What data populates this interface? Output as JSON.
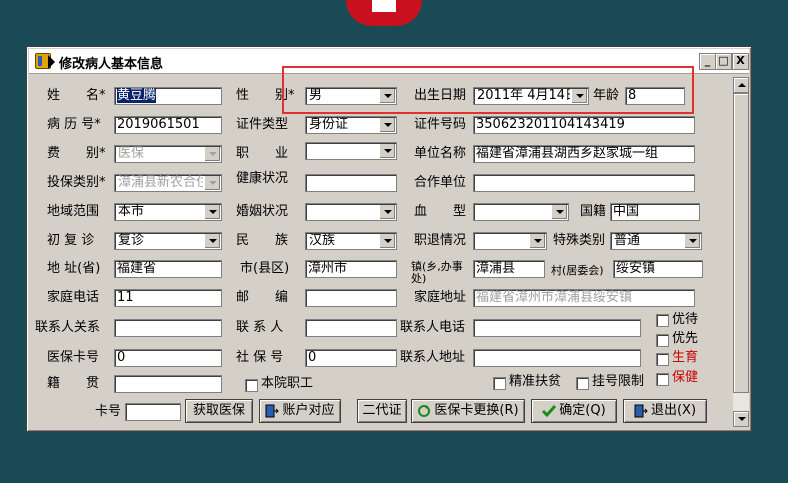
{
  "window": {
    "title": "修改病人基本信息",
    "minimize": "_",
    "maximize": "□",
    "close": "X"
  },
  "labels": {
    "name": "姓　　名*",
    "gender": "性　　别*",
    "birth": "出生日期",
    "age": "年龄",
    "record_no": "病 历 号*",
    "id_type": "证件类型",
    "id_no": "证件号码",
    "fee_type": "费　　别*",
    "job": "职　　业",
    "employer": "单位名称",
    "insure_type": "投保类别*",
    "health": "健康状况",
    "coop": "合作单位",
    "region": "地域范围",
    "marital": "婚姻状况",
    "blood": "血　　型",
    "nationality": "国籍",
    "visit": "初 复 诊",
    "ethnic": "民　　族",
    "retire": "职退情况",
    "special": "特殊类别",
    "province": "地 址(省)",
    "city": "市(县区)",
    "town": "镇(乡,办事处)",
    "village": "村(居委会)",
    "home_phone": "家庭电话",
    "postcode": "邮　　编",
    "home_addr": "家庭地址",
    "contact_rel": "联系人关系",
    "contact": "联 系 人",
    "contact_phone": "联系人电话",
    "insure_card": "医保卡号",
    "social_no": "社 保 号",
    "contact_addr": "联系人地址",
    "native": "籍　　贯",
    "staff": "本院职工",
    "precise": "精准扶贫",
    "reg_limit": "挂号限制",
    "priority": "优待",
    "first": "优先",
    "birth_care": "生育",
    "health_care": "保健",
    "card_no": "卡号"
  },
  "values": {
    "name": "黄豆腾",
    "gender": "男",
    "birth": "2011年  4月14日",
    "age": "8",
    "record_no": "2019061501",
    "id_type": "身份证",
    "id_no": "350623201104143419",
    "fee_type": "医保",
    "job": "",
    "employer": "福建省漳浦县湖西乡赵家城一组",
    "insure_type": "漳浦县新农合住院",
    "health": "",
    "coop": "",
    "region": "本市",
    "marital": "",
    "blood": "",
    "nationality": "中国",
    "visit": "复诊",
    "ethnic": "汉族",
    "retire": "",
    "special": "普通",
    "province": "福建省",
    "city": "漳州市",
    "town": "漳浦县",
    "village": "绥安镇",
    "home_phone": "11",
    "postcode": "",
    "home_addr": "福建省漳州市漳浦县绥安镇",
    "contact_rel": "",
    "contact": "",
    "contact_phone": "",
    "insure_card": "0",
    "social_no": "0",
    "contact_addr": "",
    "native": "",
    "card_no": ""
  },
  "buttons": {
    "get_insure": "获取医保",
    "account": "账户对应",
    "second_id": "二代证",
    "card_change": "医保卡更换(R)",
    "ok": "确定(Q)",
    "exit": "退出(X)"
  },
  "colors": {
    "highlight": "#e03030",
    "selection": "#0a246a",
    "red_text": "#cc0000"
  }
}
